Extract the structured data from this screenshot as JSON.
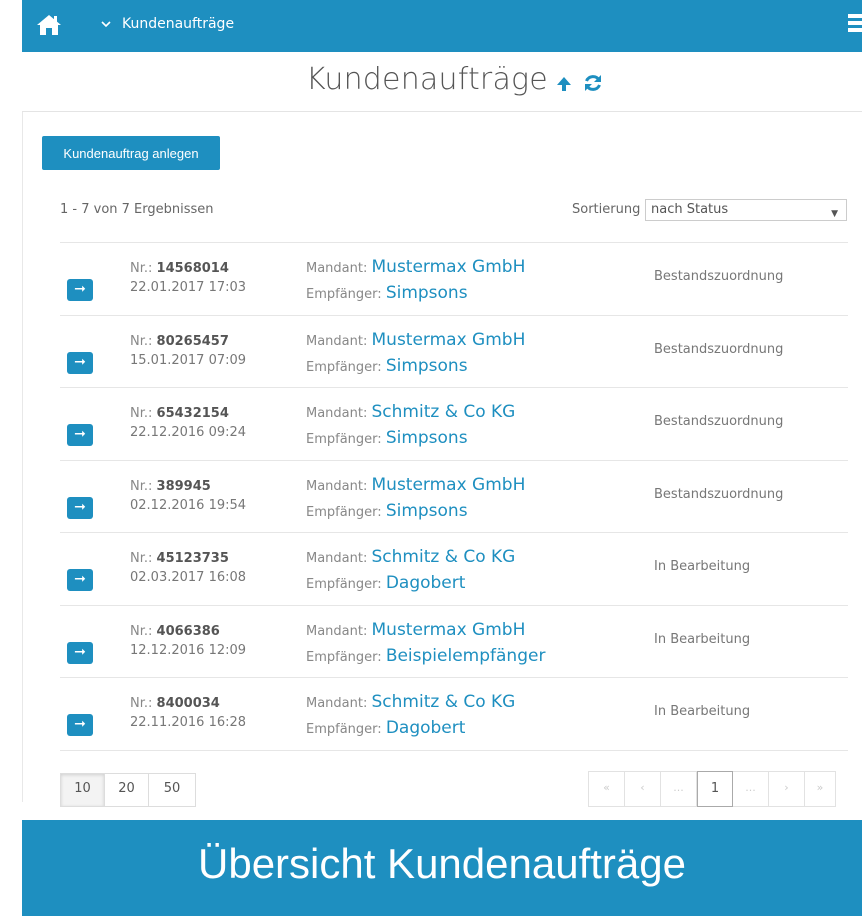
{
  "topbar": {
    "breadcrumb": "Kundenaufträge"
  },
  "header": {
    "title": "Kundenaufträge"
  },
  "toolbar": {
    "create_label": "Kundenauftrag anlegen",
    "results_text": "1 - 7 von 7 Ergebnissen",
    "sort_label": "Sortierung",
    "sort_value": "nach Status"
  },
  "labels": {
    "nr": "Nr.:",
    "mandant": "Mandant:",
    "empfaenger": "Empfänger:"
  },
  "orders": [
    {
      "nr": "14568014",
      "date": "22.01.2017 17:03",
      "mandant": "Mustermax GmbH",
      "empfaenger": "Simpsons",
      "status": "Bestandszuordnung"
    },
    {
      "nr": "80265457",
      "date": "15.01.2017 07:09",
      "mandant": "Mustermax GmbH",
      "empfaenger": "Simpsons",
      "status": "Bestandszuordnung"
    },
    {
      "nr": "65432154",
      "date": "22.12.2016 09:24",
      "mandant": "Schmitz & Co KG",
      "empfaenger": "Simpsons",
      "status": "Bestandszuordnung"
    },
    {
      "nr": "389945",
      "date": "02.12.2016 19:54",
      "mandant": "Mustermax GmbH",
      "empfaenger": "Simpsons",
      "status": "Bestandszuordnung"
    },
    {
      "nr": "45123735",
      "date": "02.03.2017 16:08",
      "mandant": "Schmitz & Co KG",
      "empfaenger": "Dagobert",
      "status": "In Bearbeitung"
    },
    {
      "nr": "4066386",
      "date": "12.12.2016 12:09",
      "mandant": "Mustermax GmbH",
      "empfaenger": "Beispielempfänger",
      "status": "In Bearbeitung"
    },
    {
      "nr": "8400034",
      "date": "22.11.2016 16:28",
      "mandant": "Schmitz & Co KG",
      "empfaenger": "Dagobert",
      "status": "In Bearbeitung"
    }
  ],
  "page_sizes": [
    "10",
    "20",
    "50"
  ],
  "pagination": {
    "first": "«",
    "prev": "‹",
    "ellipsis_left": "...",
    "current": "1",
    "ellipsis_right": "...",
    "next": "›",
    "last": "»"
  },
  "caption": "Übersicht Kundenaufträge",
  "icons": {
    "home": "home-icon",
    "breadcrumb_toggle": "chevron-down-icon",
    "menu": "hamburger-menu-icon",
    "sort": "arrow-up-icon",
    "refresh": "refresh-icon",
    "open": "arrow-right-icon"
  },
  "colors": {
    "accent": "#1e8fc0",
    "text": "#555555",
    "muted": "#888888"
  }
}
